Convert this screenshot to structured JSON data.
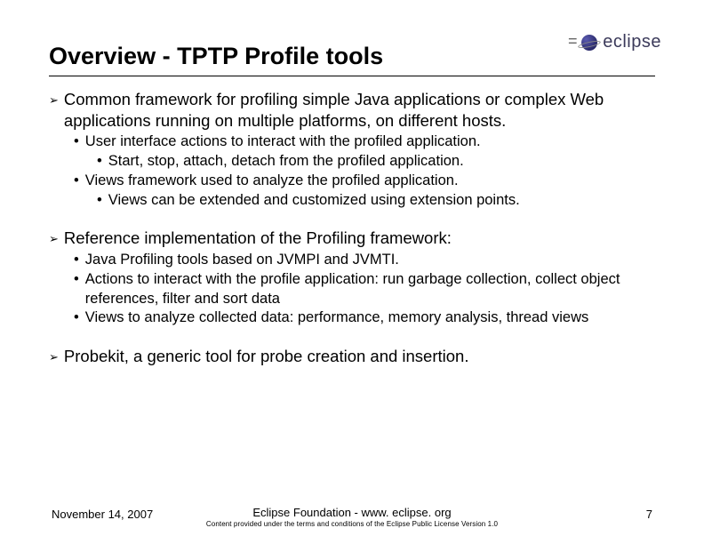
{
  "logo": {
    "text": "eclipse"
  },
  "title": "Overview - TPTP Profile tools",
  "bullets": [
    {
      "text": "Common framework for profiling simple Java applications or complex Web applications running on multiple platforms, on different hosts.",
      "subs": [
        {
          "text": "User interface actions to interact with the profiled application.",
          "subs": [
            "Start, stop, attach, detach from the profiled application."
          ]
        },
        {
          "text": "Views framework used to analyze the profiled application.",
          "subs": [
            "Views can be extended and customized using extension points."
          ]
        }
      ]
    },
    {
      "text": "Reference implementation of the Profiling framework:",
      "subs": [
        {
          "text": "Java Profiling tools based on JVMPI and JVMTI."
        },
        {
          "text": "Actions to interact with the profile application: run garbage collection, collect object references, filter and sort data"
        },
        {
          "text": "Views to analyze collected data: performance, memory analysis, thread views"
        }
      ]
    },
    {
      "text": "Probekit, a generic tool for probe creation and insertion."
    }
  ],
  "footer": {
    "date": "November 14, 2007",
    "org": "Eclipse Foundation - www. eclipse. org",
    "license": "Content provided under the terms and conditions of the Eclipse Public License Version 1.0",
    "page": "7"
  }
}
